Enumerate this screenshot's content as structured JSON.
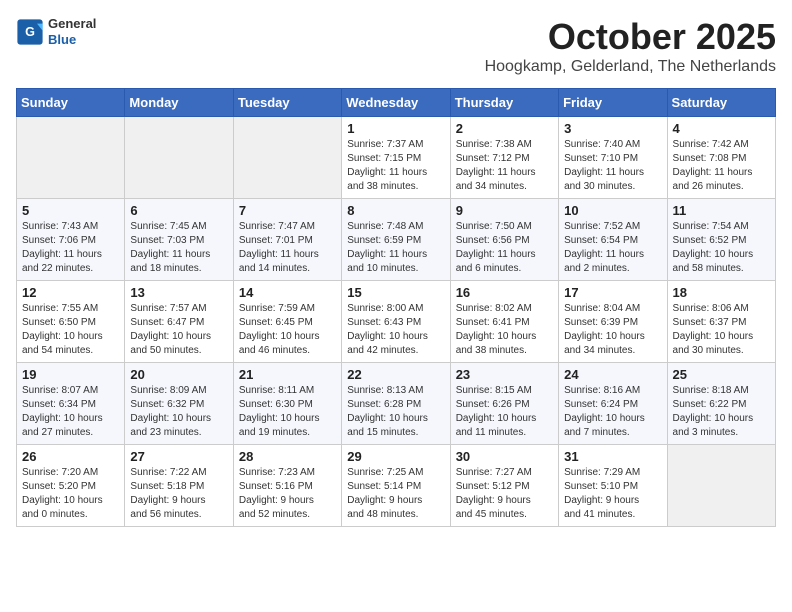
{
  "logo": {
    "general": "General",
    "blue": "Blue"
  },
  "header": {
    "month": "October 2025",
    "location": "Hoogkamp, Gelderland, The Netherlands"
  },
  "weekdays": [
    "Sunday",
    "Monday",
    "Tuesday",
    "Wednesday",
    "Thursday",
    "Friday",
    "Saturday"
  ],
  "weeks": [
    [
      {
        "day": "",
        "info": ""
      },
      {
        "day": "",
        "info": ""
      },
      {
        "day": "",
        "info": ""
      },
      {
        "day": "1",
        "info": "Sunrise: 7:37 AM\nSunset: 7:15 PM\nDaylight: 11 hours\nand 38 minutes."
      },
      {
        "day": "2",
        "info": "Sunrise: 7:38 AM\nSunset: 7:12 PM\nDaylight: 11 hours\nand 34 minutes."
      },
      {
        "day": "3",
        "info": "Sunrise: 7:40 AM\nSunset: 7:10 PM\nDaylight: 11 hours\nand 30 minutes."
      },
      {
        "day": "4",
        "info": "Sunrise: 7:42 AM\nSunset: 7:08 PM\nDaylight: 11 hours\nand 26 minutes."
      }
    ],
    [
      {
        "day": "5",
        "info": "Sunrise: 7:43 AM\nSunset: 7:06 PM\nDaylight: 11 hours\nand 22 minutes."
      },
      {
        "day": "6",
        "info": "Sunrise: 7:45 AM\nSunset: 7:03 PM\nDaylight: 11 hours\nand 18 minutes."
      },
      {
        "day": "7",
        "info": "Sunrise: 7:47 AM\nSunset: 7:01 PM\nDaylight: 11 hours\nand 14 minutes."
      },
      {
        "day": "8",
        "info": "Sunrise: 7:48 AM\nSunset: 6:59 PM\nDaylight: 11 hours\nand 10 minutes."
      },
      {
        "day": "9",
        "info": "Sunrise: 7:50 AM\nSunset: 6:56 PM\nDaylight: 11 hours\nand 6 minutes."
      },
      {
        "day": "10",
        "info": "Sunrise: 7:52 AM\nSunset: 6:54 PM\nDaylight: 11 hours\nand 2 minutes."
      },
      {
        "day": "11",
        "info": "Sunrise: 7:54 AM\nSunset: 6:52 PM\nDaylight: 10 hours\nand 58 minutes."
      }
    ],
    [
      {
        "day": "12",
        "info": "Sunrise: 7:55 AM\nSunset: 6:50 PM\nDaylight: 10 hours\nand 54 minutes."
      },
      {
        "day": "13",
        "info": "Sunrise: 7:57 AM\nSunset: 6:47 PM\nDaylight: 10 hours\nand 50 minutes."
      },
      {
        "day": "14",
        "info": "Sunrise: 7:59 AM\nSunset: 6:45 PM\nDaylight: 10 hours\nand 46 minutes."
      },
      {
        "day": "15",
        "info": "Sunrise: 8:00 AM\nSunset: 6:43 PM\nDaylight: 10 hours\nand 42 minutes."
      },
      {
        "day": "16",
        "info": "Sunrise: 8:02 AM\nSunset: 6:41 PM\nDaylight: 10 hours\nand 38 minutes."
      },
      {
        "day": "17",
        "info": "Sunrise: 8:04 AM\nSunset: 6:39 PM\nDaylight: 10 hours\nand 34 minutes."
      },
      {
        "day": "18",
        "info": "Sunrise: 8:06 AM\nSunset: 6:37 PM\nDaylight: 10 hours\nand 30 minutes."
      }
    ],
    [
      {
        "day": "19",
        "info": "Sunrise: 8:07 AM\nSunset: 6:34 PM\nDaylight: 10 hours\nand 27 minutes."
      },
      {
        "day": "20",
        "info": "Sunrise: 8:09 AM\nSunset: 6:32 PM\nDaylight: 10 hours\nand 23 minutes."
      },
      {
        "day": "21",
        "info": "Sunrise: 8:11 AM\nSunset: 6:30 PM\nDaylight: 10 hours\nand 19 minutes."
      },
      {
        "day": "22",
        "info": "Sunrise: 8:13 AM\nSunset: 6:28 PM\nDaylight: 10 hours\nand 15 minutes."
      },
      {
        "day": "23",
        "info": "Sunrise: 8:15 AM\nSunset: 6:26 PM\nDaylight: 10 hours\nand 11 minutes."
      },
      {
        "day": "24",
        "info": "Sunrise: 8:16 AM\nSunset: 6:24 PM\nDaylight: 10 hours\nand 7 minutes."
      },
      {
        "day": "25",
        "info": "Sunrise: 8:18 AM\nSunset: 6:22 PM\nDaylight: 10 hours\nand 3 minutes."
      }
    ],
    [
      {
        "day": "26",
        "info": "Sunrise: 7:20 AM\nSunset: 5:20 PM\nDaylight: 10 hours\nand 0 minutes."
      },
      {
        "day": "27",
        "info": "Sunrise: 7:22 AM\nSunset: 5:18 PM\nDaylight: 9 hours\nand 56 minutes."
      },
      {
        "day": "28",
        "info": "Sunrise: 7:23 AM\nSunset: 5:16 PM\nDaylight: 9 hours\nand 52 minutes."
      },
      {
        "day": "29",
        "info": "Sunrise: 7:25 AM\nSunset: 5:14 PM\nDaylight: 9 hours\nand 48 minutes."
      },
      {
        "day": "30",
        "info": "Sunrise: 7:27 AM\nSunset: 5:12 PM\nDaylight: 9 hours\nand 45 minutes."
      },
      {
        "day": "31",
        "info": "Sunrise: 7:29 AM\nSunset: 5:10 PM\nDaylight: 9 hours\nand 41 minutes."
      },
      {
        "day": "",
        "info": ""
      }
    ]
  ]
}
